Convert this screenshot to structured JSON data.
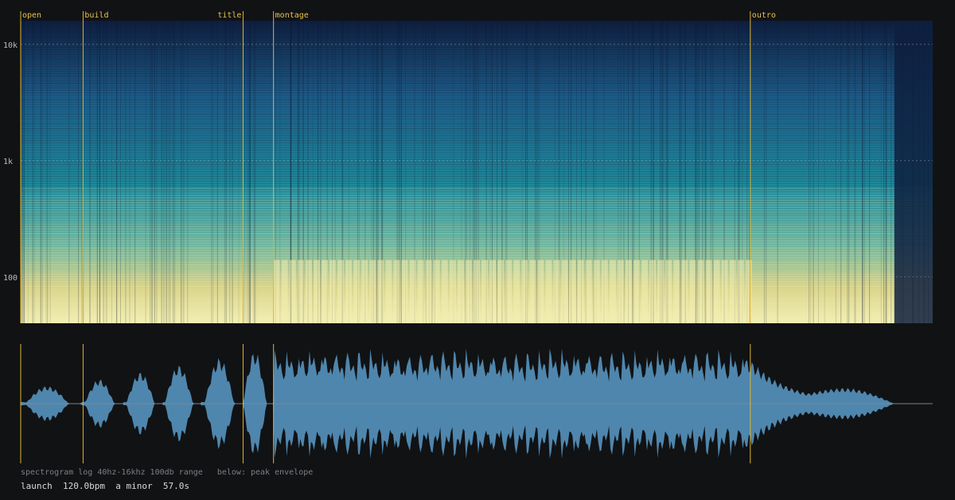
{
  "sections": [
    {
      "name": "open",
      "t": 0.0
    },
    {
      "name": "build",
      "t": 3.9
    },
    {
      "name": "title",
      "t": 13.9
    },
    {
      "name": "montage",
      "t": 15.8
    },
    {
      "name": "outro",
      "t": 45.6
    }
  ],
  "freq_ticks": [
    {
      "label": "10k",
      "hz": 10000
    },
    {
      "label": "1k",
      "hz": 1000
    },
    {
      "label": "100",
      "hz": 100
    }
  ],
  "caption": "spectrogram log 40hz-16khz 100db range   below: peak envelope",
  "track": {
    "title": "launch",
    "tempo": "120.0bpm",
    "key": "a minor",
    "duration": "57.0s"
  },
  "colors": {
    "background": "#111214",
    "marker": "#e0b52e",
    "marker_label": "#e8c24a",
    "waveform": "#4f86ad",
    "spectro_low": "#0e1e3e",
    "spectro_mid": "#1f8a9a",
    "spectro_high": "#f3efb3"
  }
}
